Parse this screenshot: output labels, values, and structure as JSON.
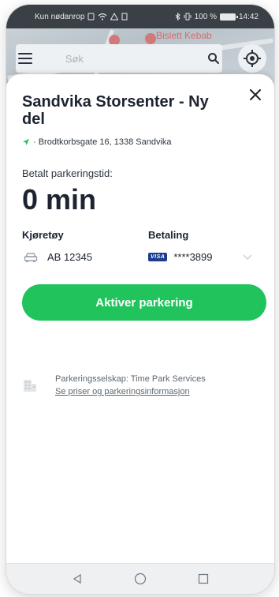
{
  "status_bar": {
    "carrier": "Kun nødanrop",
    "battery": "100 %",
    "time": "14:42"
  },
  "map": {
    "poi_label": "Bislett Kebab",
    "search": {
      "placeholder": "Søk"
    }
  },
  "sheet": {
    "title": "Sandvika Storsenter - Ny del",
    "address": "· Brodtkorbsgate 16, 1338 Sandvika",
    "paid_label": "Betalt parkeringstid:",
    "paid_value": "0 min",
    "vehicle_header": "Kjøretøy",
    "payment_header": "Betaling",
    "vehicle_plate": "AB 12345",
    "card_brand": "VISA",
    "card_number": "****3899",
    "activate_button": "Aktiver parkering",
    "operator_text": "Parkeringsselskap: Time Park Services",
    "operator_link": "Se priser og parkeringsinformasjon"
  },
  "colors": {
    "accent": "#21c35d",
    "title": "#1c2430",
    "location_arrow": "#21c35d",
    "visa": "#1a3d8f"
  },
  "icons": {
    "menu": "hamburger-icon",
    "search": "search-icon",
    "locate": "locate-icon",
    "close": "close-icon",
    "location": "navigation-arrow-icon",
    "vehicle": "car-icon",
    "expand": "chevron-down-icon",
    "operator": "building-icon",
    "nav_back": "back-triangle-icon",
    "nav_home": "home-circle-icon",
    "nav_recent": "recents-square-icon"
  }
}
